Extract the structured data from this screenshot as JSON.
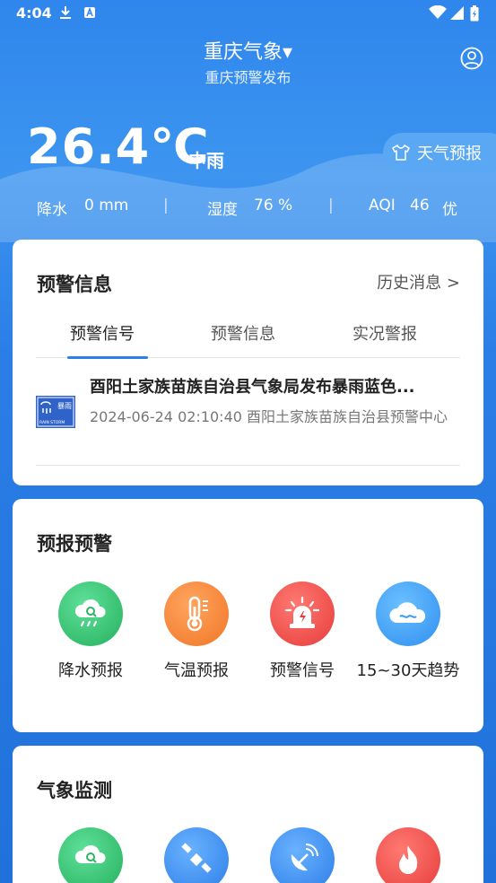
{
  "status_bar": {
    "time": "4:04"
  },
  "header": {
    "city": "重庆气象▾",
    "subtitle": "重庆预警发布"
  },
  "weather": {
    "temperature": "26.4℃",
    "condition": "中雨",
    "forecast_button": "天气预报",
    "precip_label": "降水",
    "precip_value": "0 mm",
    "humidity_label": "湿度",
    "humidity_value": "76 %",
    "aqi_label": "AQI",
    "aqi_value": "46",
    "aqi_level": "优",
    "separator": "|"
  },
  "warning_card": {
    "title": "预警信息",
    "history_link": "历史消息 >",
    "tabs": [
      "预警信号",
      "预警信息",
      "实况警报"
    ],
    "item": {
      "badge_text_top": "暴雨",
      "badge_text_bottom": "RAIN STORM",
      "title": "酉阳土家族苗族自治县气象局发布暴雨蓝色...",
      "meta": "2024-06-24 02:10:40   酉阳土家族苗族自治县预警中心"
    }
  },
  "forecast_card": {
    "title": "预报预警",
    "items": [
      {
        "label": "降水预报",
        "icon": "rain-forecast-icon",
        "color": "#33c56f"
      },
      {
        "label": "气温预报",
        "icon": "thermometer-icon",
        "color": "#f58a3a"
      },
      {
        "label": "预警信号",
        "icon": "alarm-icon",
        "color": "#ef4b4b"
      },
      {
        "label": "15~30天趋势",
        "icon": "cloud-trend-icon",
        "color": "#3d9cf0"
      }
    ]
  },
  "monitor_card": {
    "title": "气象监测",
    "items": [
      {
        "icon": "rain-monitor-icon",
        "color": "#33c56f"
      },
      {
        "icon": "satellite-icon",
        "color": "#3d8ef0"
      },
      {
        "icon": "radar-icon",
        "color": "#3d8ef0"
      },
      {
        "icon": "fire-icon",
        "color": "#ef4b4b"
      }
    ]
  }
}
